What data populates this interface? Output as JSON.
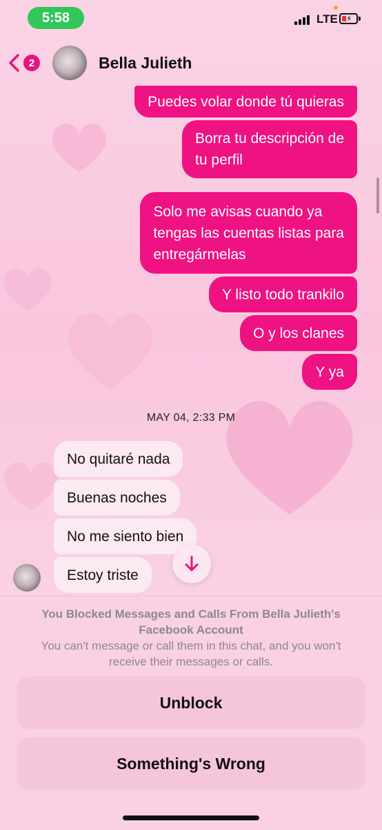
{
  "status_bar": {
    "time": "5:58",
    "network": "LTE"
  },
  "header": {
    "back_count": "2",
    "contact_name": "Bella Julieth"
  },
  "messages_out": [
    {
      "lines": [
        "Puedes volar donde tú quieras"
      ]
    },
    {
      "lines": [
        "Borra tu descripción de",
        "tu perfil"
      ]
    },
    {
      "lines": [
        "Solo me avisas cuando ya",
        "tengas las cuentas listas para",
        "entregármelas"
      ]
    },
    {
      "lines": [
        "Y listo todo trankilo"
      ]
    },
    {
      "lines": [
        "O y los clanes"
      ]
    },
    {
      "lines": [
        "Y ya"
      ]
    }
  ],
  "timestamp": "MAY 04, 2:33 PM",
  "messages_in": [
    {
      "text": "No quitaré nada"
    },
    {
      "text": "Buenas noches"
    },
    {
      "text": "No me siento bien"
    },
    {
      "text": "Estoy triste"
    }
  ],
  "footer": {
    "blocked_title": "You Blocked Messages and Calls From Bella Julieth's Facebook Account",
    "blocked_description": "You can't message or call them in this chat, and you won't receive their messages or calls.",
    "unblock_label": "Unblock",
    "something_wrong_label": "Something's Wrong"
  },
  "colors": {
    "accent": "#ef1282",
    "status_green": "#32c75a"
  }
}
